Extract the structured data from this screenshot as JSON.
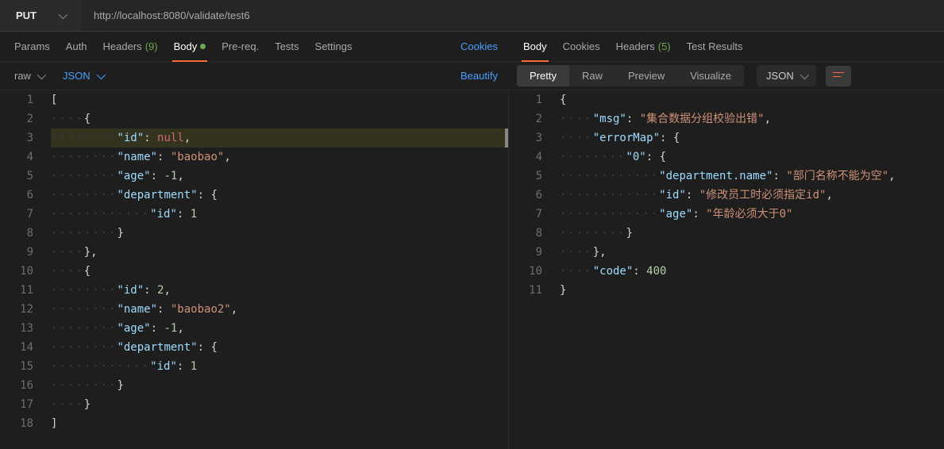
{
  "request": {
    "method": "PUT",
    "url": "http://localhost:8080/validate/test6",
    "tabs": {
      "params": "Params",
      "auth": "Auth",
      "headers": "Headers",
      "headers_count": "(9)",
      "body": "Body",
      "prereq": "Pre-req.",
      "tests": "Tests",
      "settings": "Settings"
    },
    "cookies_link": "Cookies",
    "body_type": "raw",
    "body_lang": "JSON",
    "beautify": "Beautify"
  },
  "response": {
    "tabs": {
      "body": "Body",
      "cookies": "Cookies",
      "headers": "Headers",
      "headers_count": "(5)",
      "test_results": "Test Results"
    },
    "views": {
      "pretty": "Pretty",
      "raw": "Raw",
      "preview": "Preview",
      "visualize": "Visualize"
    },
    "lang": "JSON"
  },
  "req_code": [
    {
      "indent": 0,
      "t": [
        {
          "c": "tk-brace",
          "v": "["
        }
      ]
    },
    {
      "indent": 1,
      "t": [
        {
          "c": "tk-brace",
          "v": "{"
        }
      ]
    },
    {
      "indent": 2,
      "hl": true,
      "t": [
        {
          "c": "tk-key",
          "v": "\"id\""
        },
        {
          "c": "tk-punc",
          "v": ": "
        },
        {
          "c": "tk-null",
          "v": "null"
        },
        {
          "c": "tk-punc",
          "v": ","
        }
      ]
    },
    {
      "indent": 2,
      "t": [
        {
          "c": "tk-key",
          "v": "\"name\""
        },
        {
          "c": "tk-punc",
          "v": ": "
        },
        {
          "c": "tk-str",
          "v": "\"baobao\""
        },
        {
          "c": "tk-punc",
          "v": ","
        }
      ]
    },
    {
      "indent": 2,
      "t": [
        {
          "c": "tk-key",
          "v": "\"age\""
        },
        {
          "c": "tk-punc",
          "v": ": "
        },
        {
          "c": "tk-num",
          "v": "-1"
        },
        {
          "c": "tk-punc",
          "v": ","
        }
      ]
    },
    {
      "indent": 2,
      "t": [
        {
          "c": "tk-key",
          "v": "\"department\""
        },
        {
          "c": "tk-punc",
          "v": ": "
        },
        {
          "c": "tk-brace",
          "v": "{"
        }
      ]
    },
    {
      "indent": 3,
      "t": [
        {
          "c": "tk-key",
          "v": "\"id\""
        },
        {
          "c": "tk-punc",
          "v": ": "
        },
        {
          "c": "tk-num",
          "v": "1"
        }
      ]
    },
    {
      "indent": 2,
      "t": [
        {
          "c": "tk-brace",
          "v": "}"
        }
      ]
    },
    {
      "indent": 1,
      "t": [
        {
          "c": "tk-brace",
          "v": "}"
        },
        {
          "c": "tk-punc",
          "v": ","
        }
      ]
    },
    {
      "indent": 1,
      "t": [
        {
          "c": "tk-brace",
          "v": "{"
        }
      ]
    },
    {
      "indent": 2,
      "t": [
        {
          "c": "tk-key",
          "v": "\"id\""
        },
        {
          "c": "tk-punc",
          "v": ": "
        },
        {
          "c": "tk-num",
          "v": "2"
        },
        {
          "c": "tk-punc",
          "v": ","
        }
      ]
    },
    {
      "indent": 2,
      "t": [
        {
          "c": "tk-key",
          "v": "\"name\""
        },
        {
          "c": "tk-punc",
          "v": ": "
        },
        {
          "c": "tk-str",
          "v": "\"baobao2\""
        },
        {
          "c": "tk-punc",
          "v": ","
        }
      ]
    },
    {
      "indent": 2,
      "t": [
        {
          "c": "tk-key",
          "v": "\"age\""
        },
        {
          "c": "tk-punc",
          "v": ": "
        },
        {
          "c": "tk-num",
          "v": "-1"
        },
        {
          "c": "tk-punc",
          "v": ","
        }
      ]
    },
    {
      "indent": 2,
      "t": [
        {
          "c": "tk-key",
          "v": "\"department\""
        },
        {
          "c": "tk-punc",
          "v": ": "
        },
        {
          "c": "tk-brace",
          "v": "{"
        }
      ]
    },
    {
      "indent": 3,
      "t": [
        {
          "c": "tk-key",
          "v": "\"id\""
        },
        {
          "c": "tk-punc",
          "v": ": "
        },
        {
          "c": "tk-num",
          "v": "1"
        }
      ]
    },
    {
      "indent": 2,
      "t": [
        {
          "c": "tk-brace",
          "v": "}"
        }
      ]
    },
    {
      "indent": 1,
      "t": [
        {
          "c": "tk-brace",
          "v": "}"
        }
      ]
    },
    {
      "indent": 0,
      "t": [
        {
          "c": "tk-brace",
          "v": "]"
        }
      ]
    }
  ],
  "res_code": [
    {
      "indent": 0,
      "t": [
        {
          "c": "tk-brace",
          "v": "{"
        }
      ]
    },
    {
      "indent": 1,
      "t": [
        {
          "c": "tk-key",
          "v": "\"msg\""
        },
        {
          "c": "tk-punc",
          "v": ": "
        },
        {
          "c": "tk-str",
          "v": "\"集合数据分组校验出错\""
        },
        {
          "c": "tk-punc",
          "v": ","
        }
      ]
    },
    {
      "indent": 1,
      "t": [
        {
          "c": "tk-key",
          "v": "\"errorMap\""
        },
        {
          "c": "tk-punc",
          "v": ": "
        },
        {
          "c": "tk-brace",
          "v": "{"
        }
      ]
    },
    {
      "indent": 2,
      "t": [
        {
          "c": "tk-key",
          "v": "\"0\""
        },
        {
          "c": "tk-punc",
          "v": ": "
        },
        {
          "c": "tk-brace",
          "v": "{"
        }
      ]
    },
    {
      "indent": 3,
      "t": [
        {
          "c": "tk-key",
          "v": "\"department.name\""
        },
        {
          "c": "tk-punc",
          "v": ": "
        },
        {
          "c": "tk-str",
          "v": "\"部门名称不能为空\""
        },
        {
          "c": "tk-punc",
          "v": ","
        }
      ]
    },
    {
      "indent": 3,
      "t": [
        {
          "c": "tk-key",
          "v": "\"id\""
        },
        {
          "c": "tk-punc",
          "v": ": "
        },
        {
          "c": "tk-str",
          "v": "\"修改员工时必须指定id\""
        },
        {
          "c": "tk-punc",
          "v": ","
        }
      ]
    },
    {
      "indent": 3,
      "t": [
        {
          "c": "tk-key",
          "v": "\"age\""
        },
        {
          "c": "tk-punc",
          "v": ": "
        },
        {
          "c": "tk-str",
          "v": "\"年龄必须大于0\""
        }
      ]
    },
    {
      "indent": 2,
      "t": [
        {
          "c": "tk-brace",
          "v": "}"
        }
      ]
    },
    {
      "indent": 1,
      "t": [
        {
          "c": "tk-brace",
          "v": "}"
        },
        {
          "c": "tk-punc",
          "v": ","
        }
      ]
    },
    {
      "indent": 1,
      "t": [
        {
          "c": "tk-key",
          "v": "\"code\""
        },
        {
          "c": "tk-punc",
          "v": ": "
        },
        {
          "c": "tk-num",
          "v": "400"
        }
      ]
    },
    {
      "indent": 0,
      "t": [
        {
          "c": "tk-brace",
          "v": "}"
        }
      ]
    }
  ]
}
